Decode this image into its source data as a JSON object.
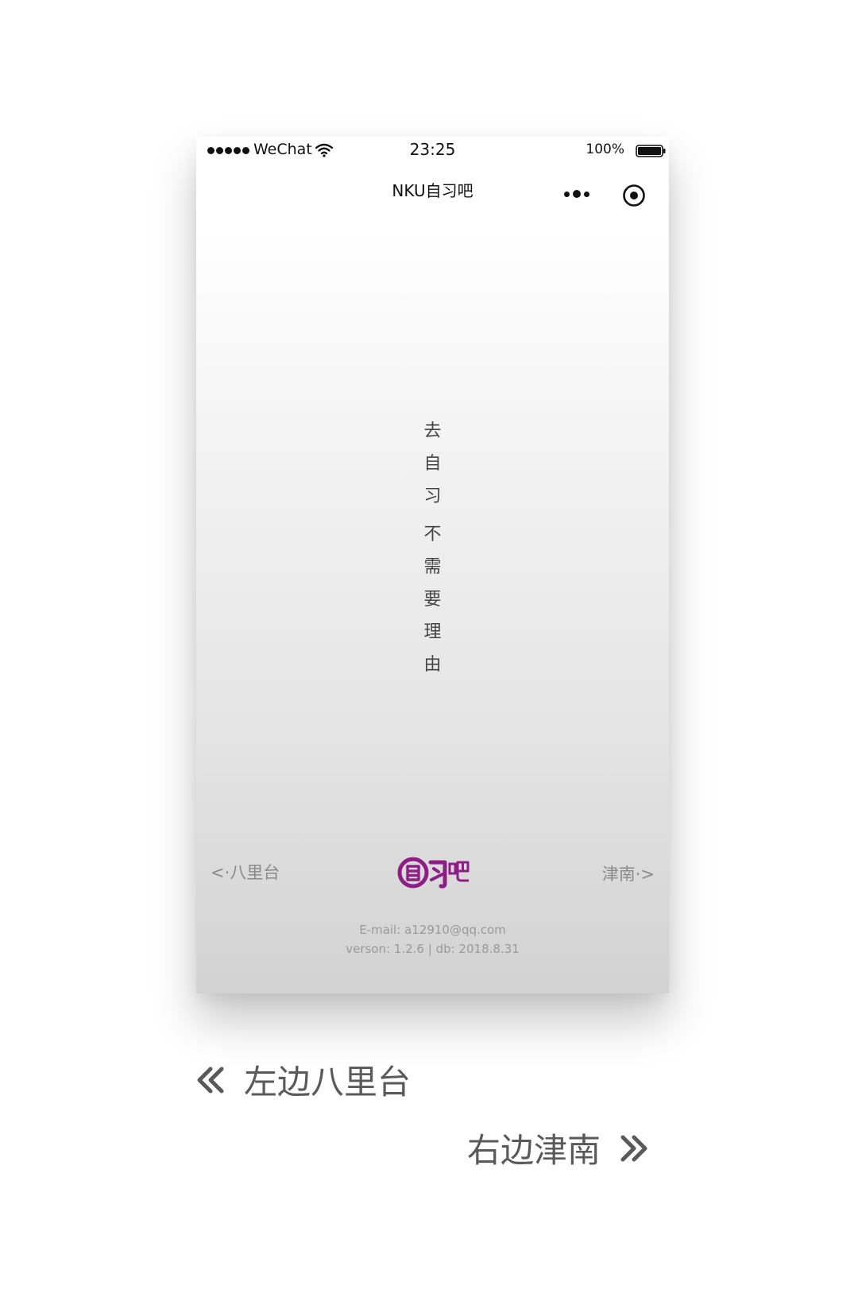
{
  "status_bar": {
    "carrier": "WeChat",
    "time": "23:25",
    "battery": "100%"
  },
  "nav": {
    "title": "NKU自习吧"
  },
  "slogan": {
    "group1": [
      "去",
      "自",
      "习"
    ],
    "group2": [
      "不",
      "需",
      "要",
      "理",
      "由"
    ]
  },
  "bottom_nav": {
    "left": "<·八里台",
    "right": "津南·>",
    "logo_text": "自习吧"
  },
  "footer": {
    "email": "E-mail: a12910@qq.com",
    "version": "verson: 1.2.6 | db: 2018.8.31"
  },
  "captions": {
    "left": "左边八里台",
    "right": "右边津南"
  },
  "colors": {
    "logo": "#8e1e86",
    "text_muted": "#8a8a8a",
    "caption": "#5a5a5a"
  },
  "icons": {
    "signal": "signal-dots-icon",
    "wifi": "wifi-icon",
    "battery": "battery-icon",
    "more": "more-dots-icon",
    "target": "target-icon",
    "double_left": "double-chevron-left-icon",
    "double_right": "double-chevron-right-icon"
  }
}
